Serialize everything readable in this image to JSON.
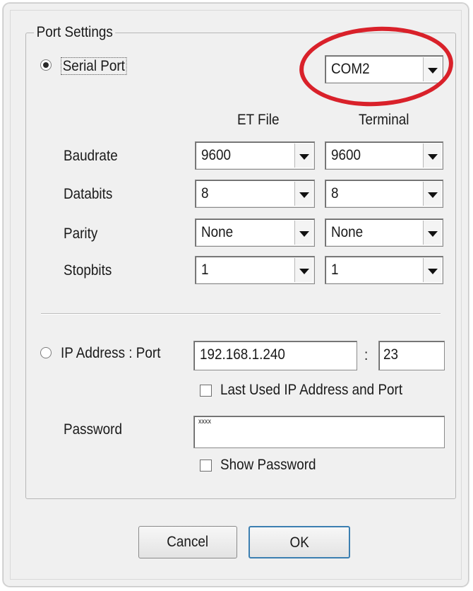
{
  "group_title": "Port Settings",
  "serial_port": {
    "label": "Serial Port",
    "selected": true,
    "com_port": "COM2"
  },
  "columns": {
    "et_file": "ET File",
    "terminal": "Terminal"
  },
  "settings": [
    {
      "label": "Baudrate",
      "et_file": "9600",
      "terminal": "9600"
    },
    {
      "label": "Databits",
      "et_file": "8",
      "terminal": "8"
    },
    {
      "label": "Parity",
      "et_file": "None",
      "terminal": "None"
    },
    {
      "label": "Stopbits",
      "et_file": "1",
      "terminal": "1"
    }
  ],
  "ip": {
    "label": "IP Address : Port",
    "selected": false,
    "address": "192.168.1.240",
    "separator": ":",
    "port": "23",
    "last_used_label": "Last Used IP Address and Port",
    "last_used_checked": false
  },
  "password": {
    "label": "Password",
    "value": "xxxx",
    "show_label": "Show Password",
    "show_checked": false
  },
  "buttons": {
    "cancel": "Cancel",
    "ok": "OK"
  },
  "colors": {
    "annotation": "#d9212a",
    "dialog_bg": "#f0f0f0",
    "default_button_border": "#3c7fb1"
  }
}
